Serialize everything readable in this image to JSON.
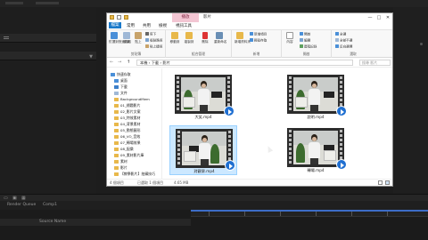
{
  "host": {
    "panels": [
      "Render Queue",
      "Comp1"
    ],
    "layer_header": "Source Name"
  },
  "window": {
    "title": "影片",
    "context_tab": "播放",
    "controls": [
      "—",
      "□",
      "✕"
    ],
    "ribbon_tabs": [
      "檔案",
      "常用",
      "共用",
      "檢視",
      "視訊工具"
    ],
    "ribbon_groups": {
      "clipboard": {
        "label": "剪貼簿",
        "pin": "釘選到快速存取",
        "copy": "複製",
        "paste": "貼上",
        "cut": "剪下",
        "copy_path": "複製路徑",
        "paste_shortcut": "貼上捷徑"
      },
      "organize": {
        "label": "組合管理",
        "move_to": "移動到",
        "copy_to": "複製到",
        "delete": "刪除",
        "rename": "重新命名"
      },
      "new": {
        "label": "新增",
        "new_folder": "新增資料夾",
        "new_item": "新增項目",
        "easy_access": "輕鬆存取"
      },
      "open": {
        "label": "開啟",
        "properties": "內容",
        "open": "開啟",
        "edit": "編輯",
        "history": "歷程記錄"
      },
      "select": {
        "label": "選取",
        "select_all": "全選",
        "select_none": "全部不選",
        "invert": "反向選擇"
      }
    },
    "address": {
      "back": "←",
      "forward": "→",
      "up": "↑",
      "path": "本機 › 下載 › 影片",
      "search_placeholder": "搜尋 影片"
    },
    "nav": [
      {
        "label": "快速存取",
        "kind": "star"
      },
      {
        "label": "桌面",
        "kind": "desktop"
      },
      {
        "label": "下載",
        "kind": "download"
      },
      {
        "label": "文件",
        "kind": "doc"
      },
      {
        "label": "BackgroundMem",
        "kind": "folder"
      },
      {
        "label": "01_標題影片",
        "kind": "folder"
      },
      {
        "label": "02_影片文案",
        "kind": "folder"
      },
      {
        "label": "03_特效素材",
        "kind": "folder"
      },
      {
        "label": "04_背景素材",
        "kind": "folder"
      },
      {
        "label": "05_動態圖形",
        "kind": "folder"
      },
      {
        "label": "06_VO_音效",
        "kind": "folder"
      },
      {
        "label": "07_轉場效果",
        "kind": "folder"
      },
      {
        "label": "08_配樂",
        "kind": "folder"
      },
      {
        "label": "09_素材影片庫",
        "kind": "folder"
      },
      {
        "label": "素材",
        "kind": "folder"
      },
      {
        "label": "影片",
        "kind": "folder"
      },
      {
        "label": "【教學影片】拍攝技巧",
        "kind": "folder"
      }
    ],
    "files": [
      {
        "name": "大笑.mp4",
        "selected": false
      },
      {
        "name": "說明.mp4",
        "selected": false
      },
      {
        "name": "對觀眾.mp4",
        "selected": true
      },
      {
        "name": "轉場.mp4",
        "selected": false
      }
    ],
    "status": {
      "items": "4 個項目",
      "selected": "已選取 1 個項目",
      "size": "4.65 MB"
    }
  },
  "colors": {
    "accent": "#1979ca",
    "selection": "#cce8ff",
    "play": "#1f6fd1",
    "folder": "#e8b84a",
    "context_tab": "#f3c6d3"
  }
}
